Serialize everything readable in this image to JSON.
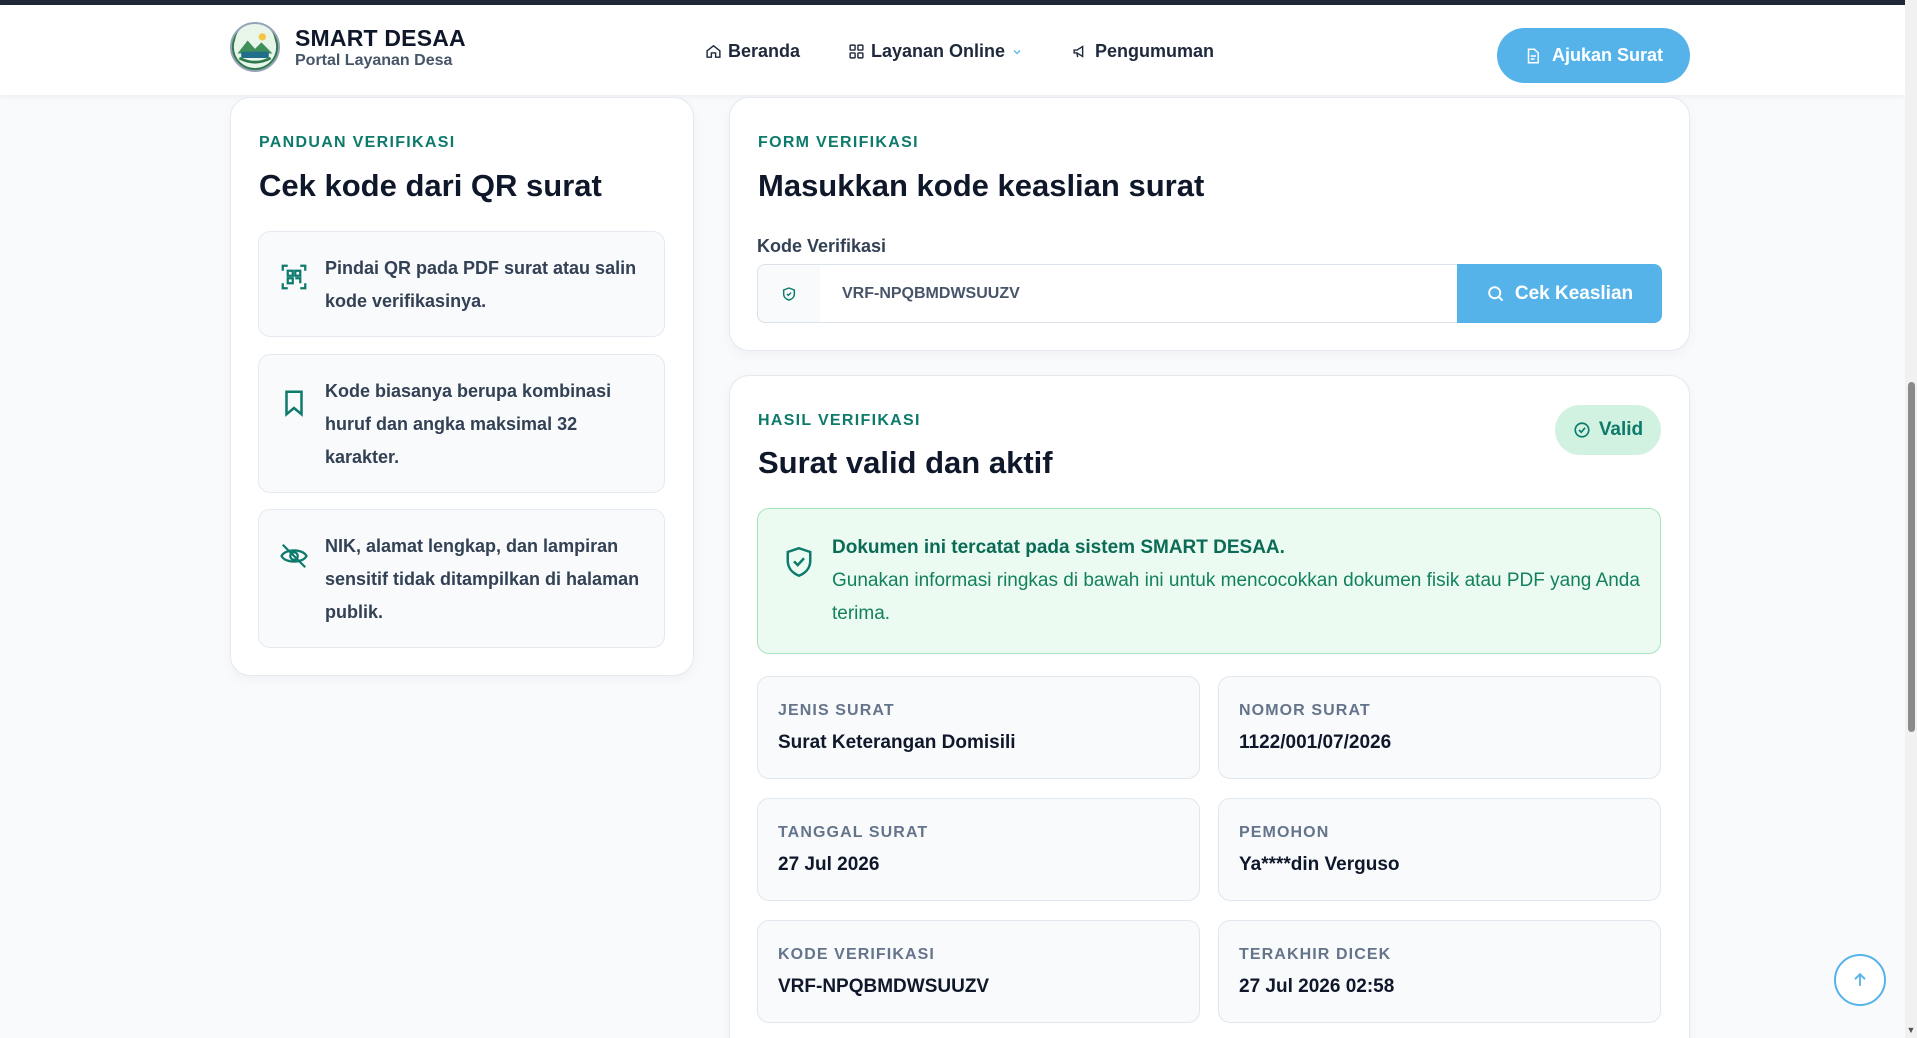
{
  "brand": {
    "title": "SMART DESAA",
    "subtitle": "Portal Layanan Desa"
  },
  "nav": {
    "items": [
      {
        "label": "Beranda",
        "icon": "home-icon"
      },
      {
        "label": "Layanan Online",
        "icon": "grid-icon"
      },
      {
        "label": "Pengumuman",
        "icon": "megaphone-icon"
      }
    ],
    "cta_label": "Ajukan Surat"
  },
  "guide": {
    "eyebrow": "PANDUAN VERIFIKASI",
    "title": "Cek kode dari QR surat",
    "tips": [
      {
        "icon": "qr-scan-icon",
        "text": "Pindai QR pada PDF surat atau salin kode verifikasinya."
      },
      {
        "icon": "bookmark-icon",
        "text": "Kode biasanya berupa kombinasi huruf dan angka maksimal 32 karakter."
      },
      {
        "icon": "eye-off-icon",
        "text": "NIK, alamat lengkap, dan lampiran sensitif tidak ditampilkan di halaman publik."
      }
    ]
  },
  "form": {
    "eyebrow": "FORM VERIFIKASI",
    "title": "Masukkan kode keaslian surat",
    "field_label": "Kode Verifikasi",
    "input_value": "VRF-NPQBMDWSUUZV",
    "button_label": "Cek Keaslian"
  },
  "result": {
    "eyebrow": "HASIL VERIFIKASI",
    "title": "Surat valid dan aktif",
    "badge": "Valid",
    "notice_title": "Dokumen ini tercatat pada sistem SMART DESAA.",
    "notice_body": "Gunakan informasi ringkas di bawah ini untuk mencocokkan dokumen fisik atau PDF yang Anda terima.",
    "fields": [
      {
        "label": "JENIS SURAT",
        "value": "Surat Keterangan Domisili"
      },
      {
        "label": "NOMOR SURAT",
        "value": "1122/001/07/2026"
      },
      {
        "label": "TANGGAL SURAT",
        "value": "27 Jul 2026"
      },
      {
        "label": "PEMOHON",
        "value": "Ya****din Verguso"
      },
      {
        "label": "KODE VERIFIKASI",
        "value": "VRF-NPQBMDWSUUZV"
      },
      {
        "label": "TERAKHIR DICEK",
        "value": "27 Jul 2026 02:58"
      }
    ]
  },
  "colors": {
    "accent": "#56b3ea",
    "brand_green": "#0d7a6b",
    "valid_bg": "#d1f2e0"
  }
}
